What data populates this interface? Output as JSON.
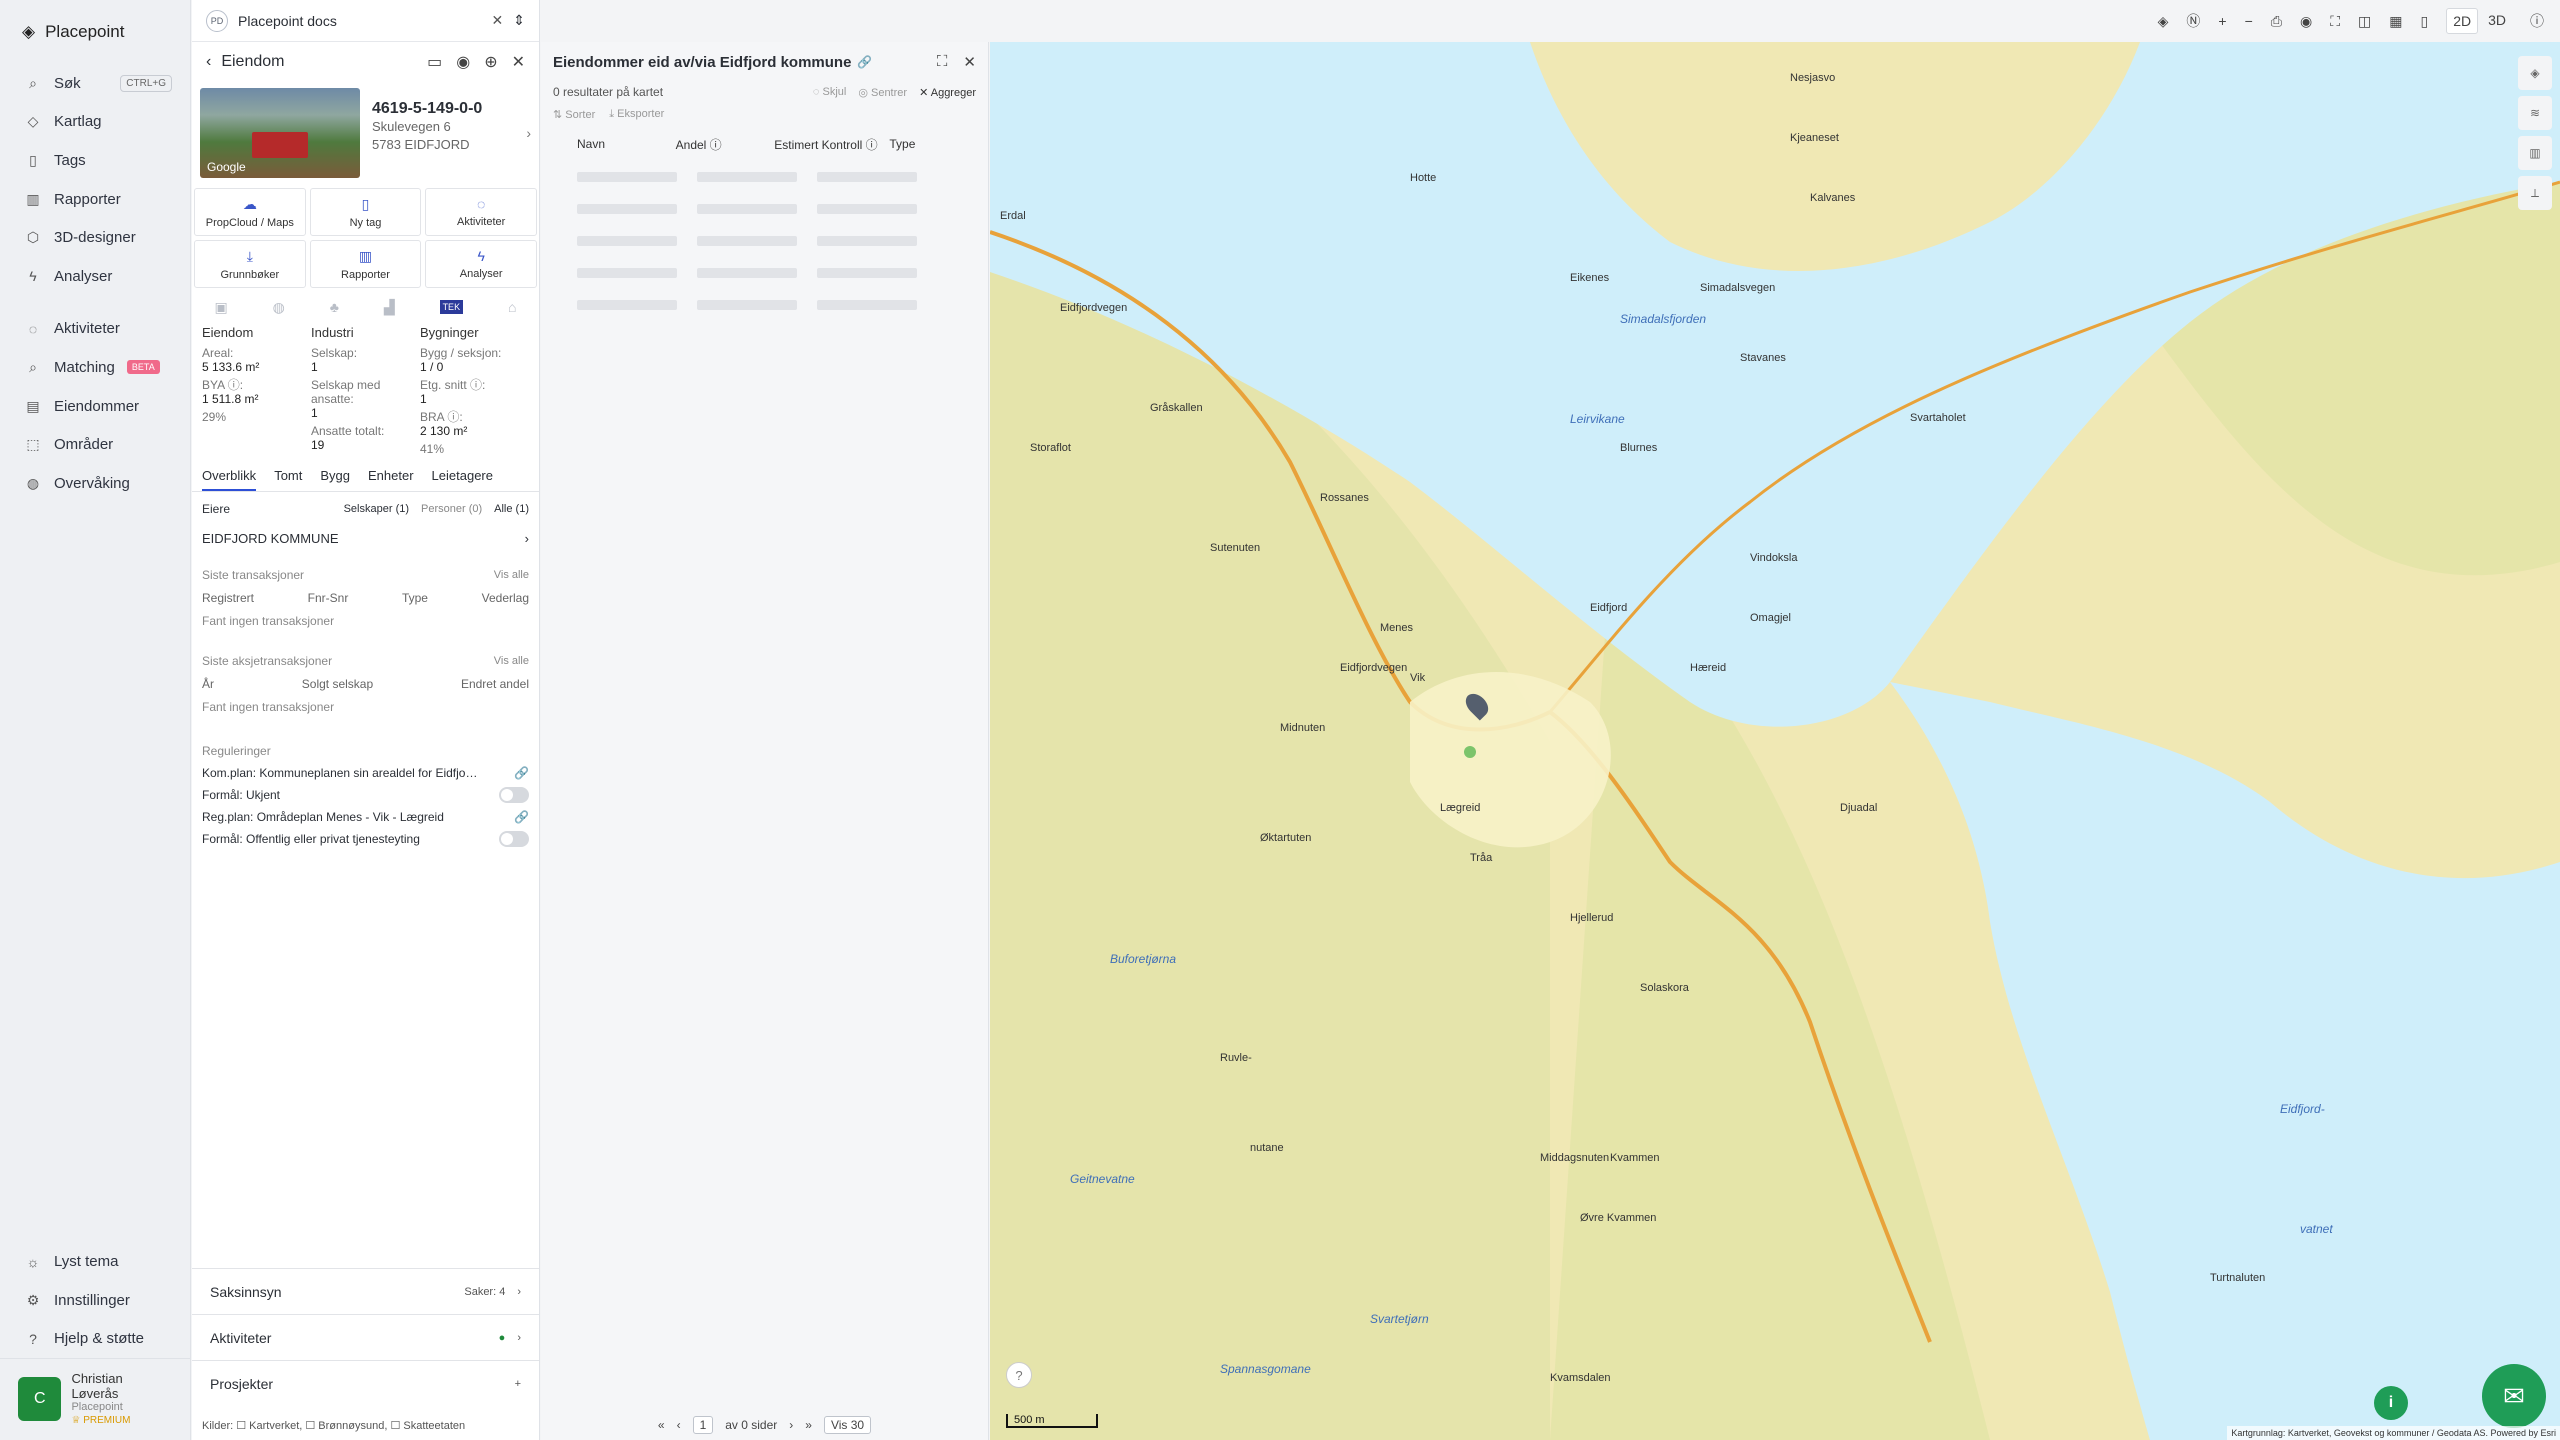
{
  "nav": {
    "brand": "Placepoint",
    "items": [
      {
        "label": "Søk",
        "kbd": "CTRL+G"
      },
      {
        "label": "Kartlag"
      },
      {
        "label": "Tags"
      },
      {
        "label": "Rapporter"
      },
      {
        "label": "3D-designer"
      },
      {
        "label": "Analyser"
      },
      {
        "label": "Aktiviteter"
      },
      {
        "label": "Matching",
        "badge": "BETA"
      },
      {
        "label": "Eiendommer"
      },
      {
        "label": "Områder"
      },
      {
        "label": "Overvåking"
      }
    ],
    "bottom": [
      {
        "label": "Lyst tema"
      },
      {
        "label": "Innstillinger"
      },
      {
        "label": "Hjelp & støtte"
      }
    ],
    "user": {
      "initial": "C",
      "name": "Christian Løverås",
      "org": "Placepoint",
      "plan": "PREMIUM"
    }
  },
  "docs": {
    "badge": "PD",
    "label": "Placepoint docs"
  },
  "property": {
    "title": "Eiendom",
    "photo_label": "Google",
    "id": "4619-5-149-0-0",
    "street": "Skulevegen 6",
    "postal": "5783 EIDFJORD",
    "buttons": [
      "PropCloud / Maps",
      "Ny tag",
      "Aktiviteter",
      "Grunnbøker",
      "Rapporter",
      "Analyser"
    ],
    "tek_label": "TEK",
    "stats": {
      "eiendom": {
        "h": "Eiendom",
        "areal_l": "Areal:",
        "areal_v": "5 133.6 m²",
        "bya_l": "BYA ⓘ:",
        "bya_v": "1 511.8 m²",
        "bya_pct": "29%"
      },
      "industri": {
        "h": "Industri",
        "selskap_l": "Selskap:",
        "selskap_v": "1",
        "ansatte_l": "Selskap med ansatte:",
        "ansatte_v": "1",
        "tot_l": "Ansatte totalt:",
        "tot_v": "19"
      },
      "bygninger": {
        "h": "Bygninger",
        "bygg_l": "Bygg / seksjon:",
        "bygg_v": "1 / 0",
        "etg_l": "Etg. snitt ⓘ:",
        "etg_v": "1",
        "bra_l": "BRA ⓘ:",
        "bra_v": "2 130 m²",
        "bra_pct": "41%"
      }
    },
    "tabs": [
      "Overblikk",
      "Tomt",
      "Bygg",
      "Enheter",
      "Leietagere"
    ],
    "eiere": {
      "label": "Eiere",
      "selskaper": "Selskaper (1)",
      "personer": "Personer (0)",
      "alle": "Alle (1)",
      "owner": "EIDFJORD KOMMUNE"
    },
    "transaksjoner": {
      "title": "Siste transaksjoner",
      "vis_alle": "Vis alle",
      "cols": [
        "Registrert",
        "Fnr-Snr",
        "Type",
        "Vederlag"
      ],
      "empty": "Fant ingen transaksjoner"
    },
    "aksje": {
      "title": "Siste aksjetransaksjoner",
      "vis_alle": "Vis alle",
      "cols": [
        "År",
        "Solgt selskap",
        "Endret andel"
      ],
      "empty": "Fant ingen transaksjoner"
    },
    "reguleringer": {
      "title": "Reguleringer",
      "kom": "Kom.plan: Kommuneplanen sin arealdel for Eidfjo…",
      "formal1": "Formål: Ukjent",
      "reg": "Reg.plan: Områdeplan Menes - Vik - Lægreid",
      "formal2": "Formål: Offentlig eller privat tjenesteyting"
    },
    "acc": {
      "saks": "Saksinnsyn",
      "saker": "Saker: 4",
      "akt": "Aktiviteter",
      "prosj": "Prosjekter"
    },
    "sources": "Kilder: ☐ Kartverket, ☐ Brønnøysund, ☐ Skatteetaten"
  },
  "list": {
    "title": "Eiendommer eid av/via Eidfjord kommune",
    "results": "0 resultater på kartet",
    "skjul": "Skjul",
    "sentrer": "Sentrer",
    "aggreger": "Aggreger",
    "sorter": "Sorter",
    "eksporter": "Eksporter",
    "cols": [
      "Navn",
      "Andel ⓘ",
      "Estimert Kontroll ⓘ",
      "Type"
    ],
    "pager": {
      "page": "1",
      "of": "av 0 sider",
      "vis": "Vis 30"
    }
  },
  "map": {
    "labels": [
      {
        "t": "Erdal"
      },
      {
        "t": "Hotte"
      },
      {
        "t": "Eikenes"
      },
      {
        "t": "Simadalsvegen"
      },
      {
        "t": "Nesjasvo"
      },
      {
        "t": "Kjeaneset"
      },
      {
        "t": "Kalvanes"
      },
      {
        "t": "Stavanes"
      },
      {
        "t": "Svartaholet"
      },
      {
        "t": "Gråskallen"
      },
      {
        "t": "Storaflot"
      },
      {
        "t": "Blurnes"
      },
      {
        "t": "Rossanes"
      },
      {
        "t": "Sutenuten"
      },
      {
        "t": "Vindoksla"
      },
      {
        "t": "Eidfjord"
      },
      {
        "t": "Omagjel"
      },
      {
        "t": "Menes"
      },
      {
        "t": "Vik"
      },
      {
        "t": "Hæreid"
      },
      {
        "t": "Midnuten"
      },
      {
        "t": "Lægreid"
      },
      {
        "t": "Djuadal"
      },
      {
        "t": "Øktartuten"
      },
      {
        "t": "Tråa"
      },
      {
        "t": "Hjellerud"
      },
      {
        "t": "Solaskora"
      },
      {
        "t": "Ruvle-"
      },
      {
        "t": "nutane"
      },
      {
        "t": "Middagsnuten"
      },
      {
        "t": "Kvammen"
      },
      {
        "t": "Øvre Kvammen"
      },
      {
        "t": "Turtnaluten"
      },
      {
        "t": "Kvamsdalen"
      },
      {
        "t": "Eidfjordvegen"
      },
      {
        "t": "Eidfjordvegen"
      }
    ],
    "water": [
      {
        "t": "Simadalsfjorden"
      },
      {
        "t": "Leirvikane"
      },
      {
        "t": "Eidfjord-"
      },
      {
        "t": "vatnet"
      },
      {
        "t": "Buforetjørna"
      },
      {
        "t": "Geitnevatne"
      },
      {
        "t": "Svartetjørn"
      },
      {
        "t": "Spannasgomane"
      }
    ],
    "scale": "500 m",
    "credit": "Kartgrunnlag: Kartverket, Geovekst og kommuner / Geodata AS. Powered by Esri"
  },
  "topbar": {
    "d2": "2D",
    "d3": "3D"
  }
}
